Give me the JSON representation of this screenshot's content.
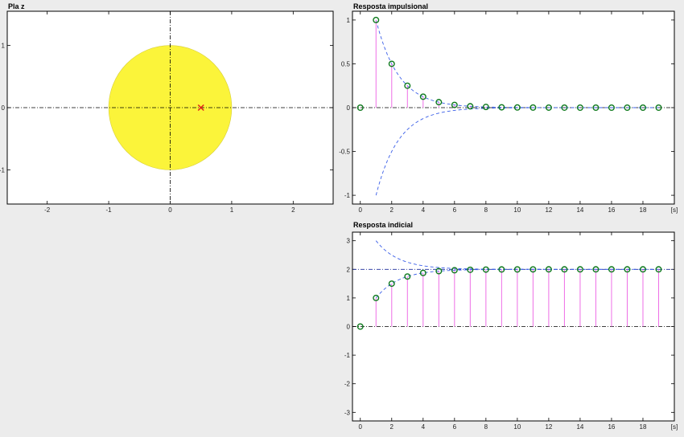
{
  "colors": {
    "background": "#ececec",
    "axes_bg": "#ffffff",
    "unit_circle_fill": "#fbf43a",
    "pole_marker": "#e0201b",
    "stem": "#ee6ee6",
    "marker_edge": "#0f7a1e",
    "envelope": "#3a5ee8",
    "axis_line": "#000000"
  },
  "chart_data": [
    {
      "id": "pz",
      "type": "scatter",
      "title": "Pla z",
      "xlim": [
        -2.65,
        2.65
      ],
      "ylim": [
        -1.55,
        1.55
      ],
      "xticks": [
        -2,
        -1,
        0,
        1,
        2
      ],
      "yticks": [
        -1,
        0,
        1
      ],
      "xtick_labels": [
        "-2",
        "-1",
        "0",
        "1",
        "2"
      ],
      "ytick_labels": [
        "-1",
        "0",
        "1"
      ],
      "unit_circle_radius": 1,
      "poles": [
        {
          "re": 0.5,
          "im": 0
        }
      ],
      "zeros": [],
      "grid": false
    },
    {
      "id": "impulse",
      "type": "stem",
      "title": "Resposta impulsional",
      "xlabel": "[s]",
      "xlim": [
        -0.5,
        20
      ],
      "ylim": [
        -1.1,
        1.1
      ],
      "xticks": [
        0,
        2,
        4,
        6,
        8,
        10,
        12,
        14,
        16,
        18
      ],
      "yticks": [
        -1,
        -0.5,
        0,
        0.5,
        1
      ],
      "xtick_labels": [
        "0",
        "2",
        "4",
        "6",
        "8",
        "10",
        "12",
        "14",
        "16",
        "18"
      ],
      "ytick_labels": [
        "-1",
        "-0.5",
        "0",
        "0.5",
        "1"
      ],
      "x": [
        0,
        1,
        2,
        3,
        4,
        5,
        6,
        7,
        8,
        9,
        10,
        11,
        12,
        13,
        14,
        15,
        16,
        17,
        18,
        19
      ],
      "values": [
        0,
        1,
        0.5,
        0.25,
        0.125,
        0.0625,
        0.03125,
        0.015625,
        0.0078,
        0.0039,
        0.002,
        0.001,
        0.0005,
        0.0002,
        0.0001,
        0.0001,
        0,
        0,
        0,
        0
      ],
      "envelope_upper": "0.5^(n-1)",
      "envelope_lower": "-0.5^(n-1)",
      "grid": false
    },
    {
      "id": "step",
      "type": "stem",
      "title": "Resposta indicial",
      "xlabel": "[s]",
      "xlim": [
        -0.5,
        20
      ],
      "ylim": [
        -3.3,
        3.3
      ],
      "xticks": [
        0,
        2,
        4,
        6,
        8,
        10,
        12,
        14,
        16,
        18
      ],
      "yticks": [
        -3,
        -2,
        -1,
        0,
        1,
        2,
        3
      ],
      "xtick_labels": [
        "0",
        "2",
        "4",
        "6",
        "8",
        "10",
        "12",
        "14",
        "16",
        "18"
      ],
      "ytick_labels": [
        "-3",
        "-2",
        "-1",
        "0",
        "1",
        "2",
        "3"
      ],
      "x": [
        0,
        1,
        2,
        3,
        4,
        5,
        6,
        7,
        8,
        9,
        10,
        11,
        12,
        13,
        14,
        15,
        16,
        17,
        18,
        19
      ],
      "values": [
        0,
        1,
        1.5,
        1.75,
        1.875,
        1.9375,
        1.96875,
        1.984,
        1.992,
        1.996,
        1.998,
        1.999,
        2,
        2,
        2,
        2,
        2,
        2,
        2,
        2
      ],
      "final_value": 2,
      "envelope_lower": "2 - 0.5^(n-1)",
      "envelope_upper": "2 + 0.5^(n-1)",
      "grid": false
    }
  ]
}
